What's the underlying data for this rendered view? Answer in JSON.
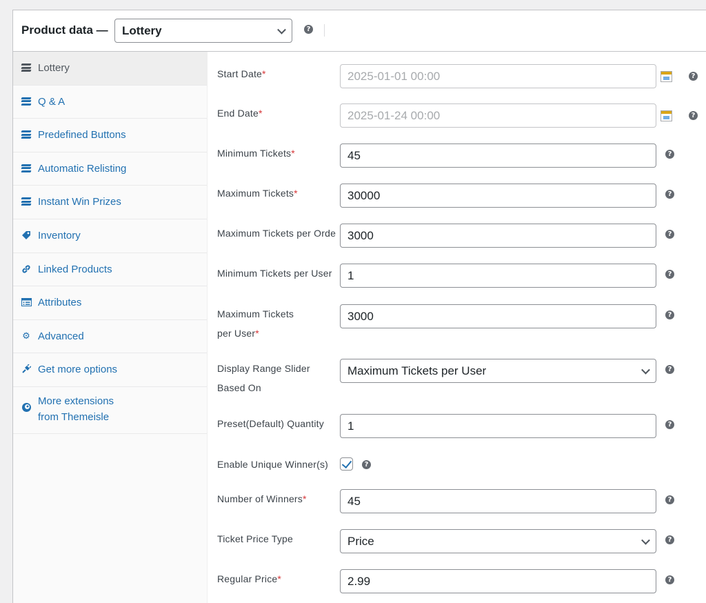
{
  "header": {
    "title": "Product data —",
    "product_type": "Lottery"
  },
  "sidebar": {
    "tabs": [
      {
        "label": "Lottery",
        "icon": "lottery-icon",
        "active": true
      },
      {
        "label": "Q & A",
        "icon": "lottery-icon"
      },
      {
        "label": "Predefined Buttons",
        "icon": "lottery-icon"
      },
      {
        "label": "Automatic Relisting",
        "icon": "lottery-icon"
      },
      {
        "label": "Instant Win Prizes",
        "icon": "lottery-icon"
      },
      {
        "label": "Inventory",
        "icon": "tag-icon"
      },
      {
        "label": "Linked Products",
        "icon": "link-icon"
      },
      {
        "label": "Attributes",
        "icon": "list-icon"
      },
      {
        "label": "Advanced",
        "icon": "gear-icon"
      },
      {
        "label": "Get more options",
        "icon": "plugin-icon"
      },
      {
        "label": "More extensions from Themeisle",
        "line1": "More extensions",
        "line2": "from Themeisle",
        "icon": "themeisle-icon"
      }
    ]
  },
  "form": {
    "start_date": {
      "label": "Start Date",
      "placeholder": "2025-01-01 00:00"
    },
    "end_date": {
      "label": "End Date",
      "placeholder": "2025-01-24 00:00"
    },
    "min_tickets": {
      "label": "Minimum Tickets",
      "value": "45"
    },
    "max_tickets": {
      "label": "Maximum Tickets",
      "value": "30000"
    },
    "max_tickets_per_order": {
      "label": "Maximum Tickets per Orde",
      "value": "3000"
    },
    "min_tickets_per_user": {
      "label": "Minimum Tickets per User",
      "value": "1"
    },
    "max_tickets_per_user": {
      "label_line1": "Maximum Tickets",
      "label_line2": "per User",
      "value": "3000"
    },
    "range_slider": {
      "label_line1": "Display Range Slider",
      "label_line2": "Based On",
      "selected": "Maximum Tickets per User"
    },
    "preset_quantity": {
      "label": "Preset(Default) Quantity",
      "value": "1"
    },
    "unique_winners": {
      "label": "Enable Unique Winner(s)",
      "checked": true
    },
    "num_winners": {
      "label": "Number of Winners",
      "value": "45"
    },
    "ticket_price_type": {
      "label": "Ticket Price Type",
      "selected": "Price"
    },
    "regular_price": {
      "label": "Regular Price",
      "value": "2.99"
    },
    "required_mark": "*",
    "help_glyph": "?"
  },
  "colors": {
    "link": "#2271b1",
    "required": "#d63638",
    "active_tab_bg": "#eeeeee",
    "checkmark": "#2271b1"
  }
}
